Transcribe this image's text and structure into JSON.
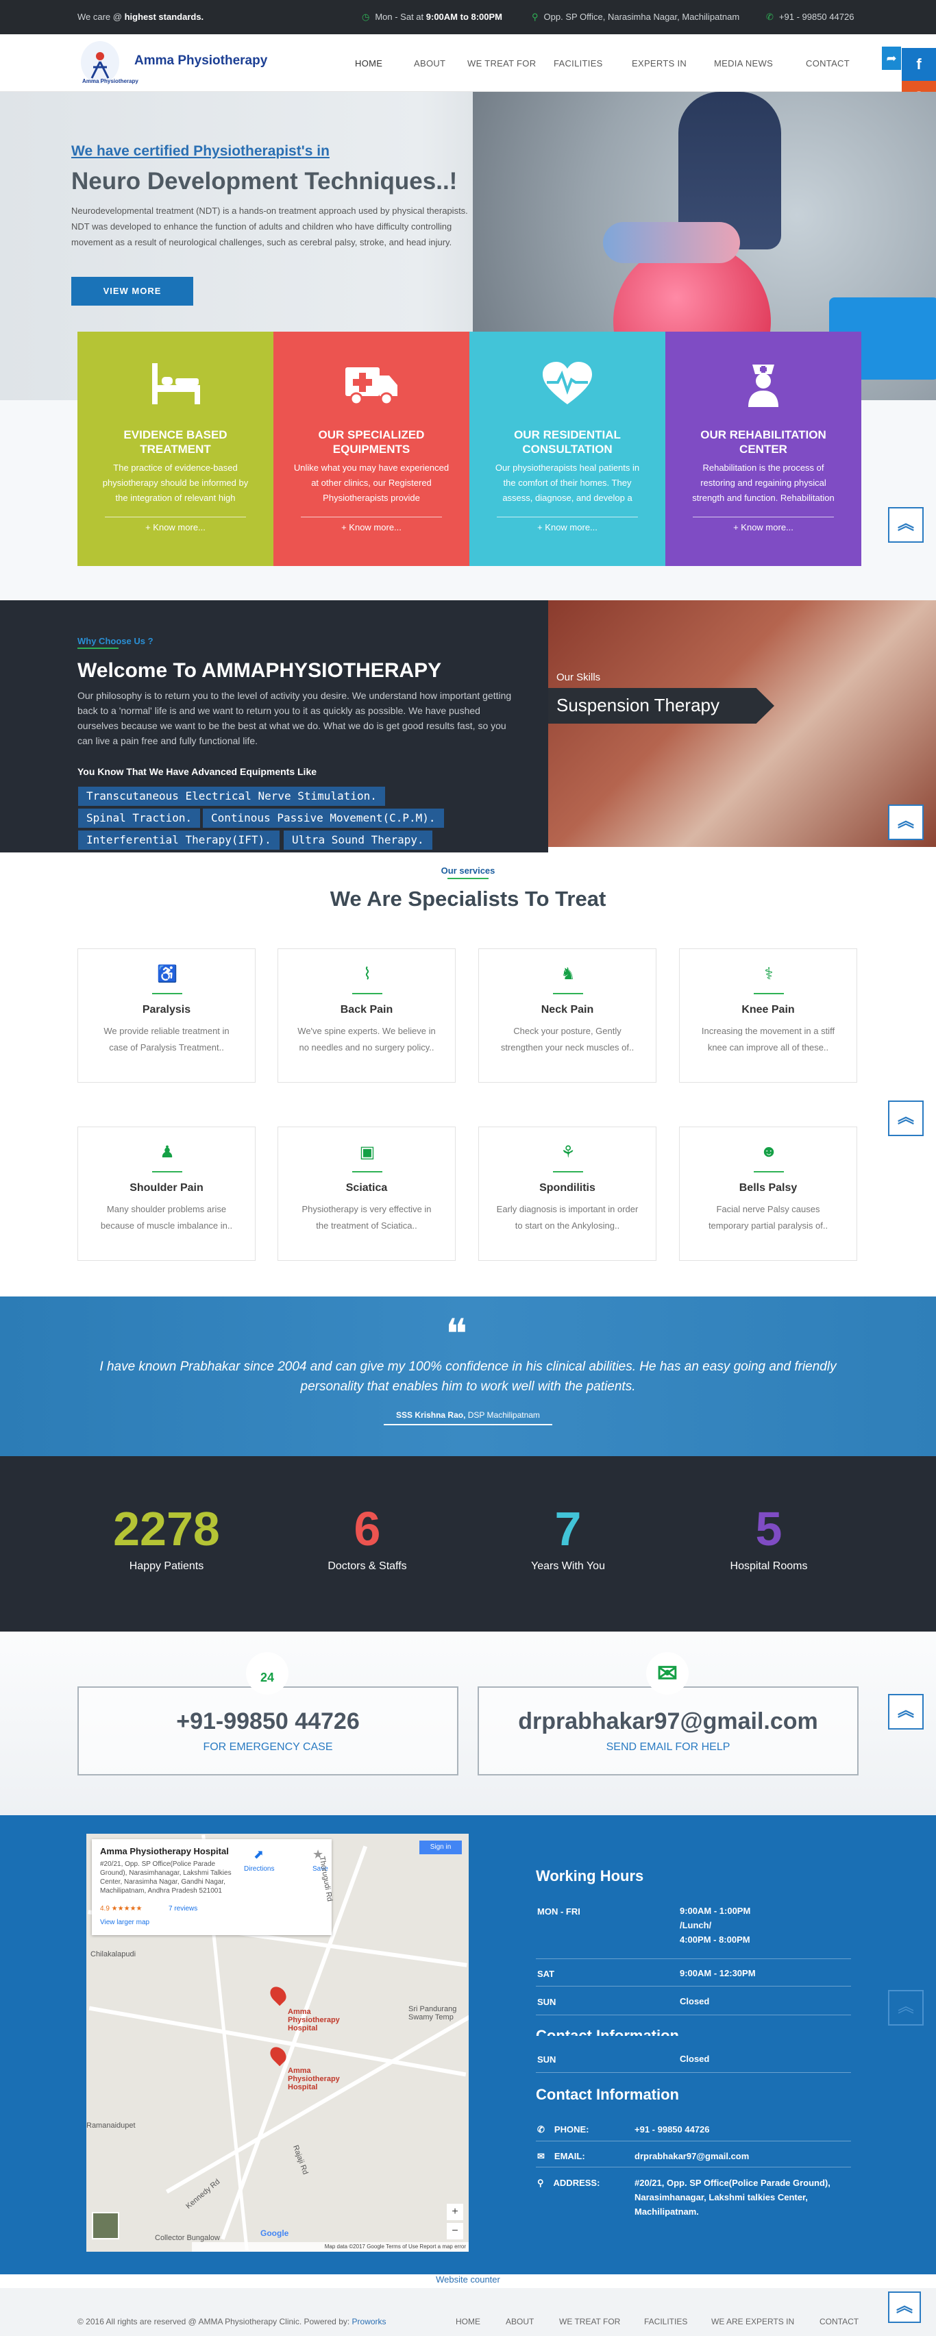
{
  "topbar": {
    "care_prefix": "We care @ ",
    "care_bold": "highest standards.",
    "hours_prefix": "Mon - Sat at ",
    "hours_bold": "9:00AM to 8:00PM",
    "address": "Opp. SP Office, Narasimha Nagar, Machilipatnam",
    "phone": "+91 - 99850 44726"
  },
  "header": {
    "logo_text": "Amma Physiotherapy",
    "logo_sub": "Amma Physiotherapy",
    "nav": [
      "HOME",
      "ABOUT",
      "WE TREAT FOR",
      "FACILITIES",
      "EXPERTS IN",
      "MEDIA NEWS",
      "CONTACT"
    ],
    "social": [
      "f",
      "G"
    ]
  },
  "hero": {
    "subtitle": "We have certified Physiotherapist's in",
    "title": "Neuro Development Techniques..!",
    "text": "Neurodevelopmental treatment (NDT) is a hands-on treatment approach used by physical therapists. NDT was developed to enhance the function of adults and children who have difficulty controlling movement as a result of neurological challenges, such as cerebral palsy, stroke, and head injury.",
    "button": "VIEW MORE"
  },
  "cards": [
    {
      "title": "EVIDENCE BASED TREATMENT",
      "text": "The practice of evidence-based physiotherapy should be informed by the integration of relevant high",
      "more": "+ Know more...",
      "color": "#b5c435",
      "icon": "bed-icon"
    },
    {
      "title": "OUR SPECIALIZED EQUIPMENTS",
      "text": "Unlike what you may have experienced at other clinics, our Registered Physiotherapists provide",
      "more": "+ Know more...",
      "color": "#ec5450",
      "icon": "ambulance-icon"
    },
    {
      "title": "OUR RESIDENTIAL CONSULTATION",
      "text": "Our physiotherapists heal patients in the comfort of their homes. They assess, diagnose, and develop a",
      "more": "+ Know more...",
      "color": "#42c4d8",
      "icon": "heartbeat-icon"
    },
    {
      "title": "OUR REHABILITATION CENTER",
      "text": "Rehabilitation is the process of restoring and regaining physical strength and function. Rehabilitation",
      "more": "+ Know more...",
      "color": "#7f4cc4",
      "icon": "nurse-icon"
    }
  ],
  "why": {
    "tag": "Why Choose Us ?",
    "title": "Welcome To AMMAPHYSIOTHERAPY",
    "text": "Our philosophy is to return you to the level of activity you desire. We understand how important getting back to a 'normal' life is and we want to return you to it as quickly as possible. We have pushed ourselves because we want to be the best at what we do. What we do is get good results fast, so you can live a pain free and fully functional life.",
    "equip_heading": "You Know That We Have Advanced Equipments Like",
    "equipments": [
      "Transcutaneous Electrical Nerve Stimulation.",
      "Spinal Traction.",
      "Continous Passive Movement(C.P.M).",
      "Interferential Therapy(IFT).",
      "Ultra Sound Therapy."
    ]
  },
  "skills": {
    "label": "Our Skills",
    "title": "Suspension Therapy"
  },
  "services": {
    "tag": "Our services",
    "title": "We Are Specialists To Treat",
    "items": [
      {
        "title": "Paralysis",
        "text": "We provide reliable treatment in case of Paralysis Treatment..",
        "icon": "paralysis-icon"
      },
      {
        "title": "Back Pain",
        "text": "We've spine experts. We believe in no needles and no surgery policy..",
        "icon": "back-icon"
      },
      {
        "title": "Neck Pain",
        "text": "Check your posture, Gently strengthen your neck muscles of..",
        "icon": "neck-icon"
      },
      {
        "title": "Knee Pain",
        "text": "Increasing the movement in a stiff knee can improve all of these..",
        "icon": "knee-icon"
      },
      {
        "title": "Shoulder Pain",
        "text": "Many shoulder problems arise because of muscle imbalance in..",
        "icon": "shoulder-icon"
      },
      {
        "title": "Sciatica",
        "text": "Physiotherapy is very effective in the treatment of Sciatica..",
        "icon": "sciatica-icon"
      },
      {
        "title": "Spondilitis",
        "text": "Early diagnosis is important in order to start on the Ankylosing..",
        "icon": "spine-icon"
      },
      {
        "title": "Bells Palsy",
        "text": "Facial nerve Palsy causes temporary partial paralysis of..",
        "icon": "face-icon"
      }
    ]
  },
  "testimonial": {
    "quote_mark": "❝",
    "text": "I have known Prabhakar since 2004 and can give my 100% confidence in his clinical abilities. He has an easy going and friendly personality that enables him to work well with the patients.",
    "author": "SSS Krishna Rao,",
    "role": "DSP Machilipatnam"
  },
  "stats": [
    {
      "number": "2278",
      "label": "Happy Patients",
      "color": "#b5c435"
    },
    {
      "number": "6",
      "label": "Doctors & Staffs",
      "color": "#ec5450"
    },
    {
      "number": "7",
      "label": "Years With You",
      "color": "#42c4d8"
    },
    {
      "number": "5",
      "label": "Hospital Rooms",
      "color": "#7f4cc4"
    }
  ],
  "contact": {
    "phone": "+91-99850 44726",
    "phone_label": "FOR EMERGENCY CASE",
    "email": "drprabhakar97@gmail.com",
    "email_label": "SEND EMAIL FOR HELP",
    "phone_badge": "24"
  },
  "map": {
    "place": "Amma Physiotherapy Hospital",
    "address": "#20/21, Opp. SP Office(Police Parade Ground), Narasimhanagar, Lakshmi Talkies Center, Narasimha Nagar, Gandhi Nagar, Machilipatnam, Andhra Pradesh 521001",
    "rating": "4.9 ★★★★★",
    "reviews": "7 reviews",
    "larger": "View larger map",
    "directions": "Directions",
    "save": "Save",
    "signin": "Sign in",
    "pin_label": "Amma Physiotherapy Hospital",
    "labels": [
      "Chilakalapudi",
      "Sri Pandurang Swamy Temp",
      "Collector Bungalow",
      "Ramanaidupet",
      "Kennedy Rd",
      "Rajaji Rd",
      "Thorugudi Rd"
    ],
    "footer": "Map data ©2017 Google   Terms of Use   Report a map error",
    "google": "Google"
  },
  "hours": {
    "title": "Working Hours",
    "rows": [
      {
        "day": "MON - FRI",
        "time1": "9:00AM - 1:00PM",
        "time2": "/Lunch/",
        "time3": "4:00PM - 8:00PM"
      },
      {
        "day": "SAT",
        "time1": "9:00AM - 12:30PM"
      },
      {
        "day": "SUN",
        "time1": "Closed"
      }
    ],
    "partial_title": "Contact Information",
    "sun_repeat": "SUN",
    "closed_repeat": "Closed",
    "contact_title": "Contact Information",
    "phone_k": "PHONE:",
    "phone_v": "+91 - 99850 44726",
    "email_k": "EMAIL:",
    "email_v": "drprabhakar97@gmail.com",
    "address_k": "ADDRESS:",
    "address_v": "#20/21, Opp. SP Office(Police Parade Ground), Narasimhanagar, Lakshmi talkies Center, Machilipatnam."
  },
  "counter": "Website counter",
  "footer": {
    "copy": "© 2016 All rights are reserved @ AMMA Physiotherapy Clinic. Powered by: ",
    "powered": "Proworks",
    "nav": [
      "HOME",
      "ABOUT",
      "WE TREAT FOR",
      "FACILITIES",
      "WE ARE EXPERTS IN",
      "CONTACT"
    ]
  },
  "up_arrow": "︽"
}
